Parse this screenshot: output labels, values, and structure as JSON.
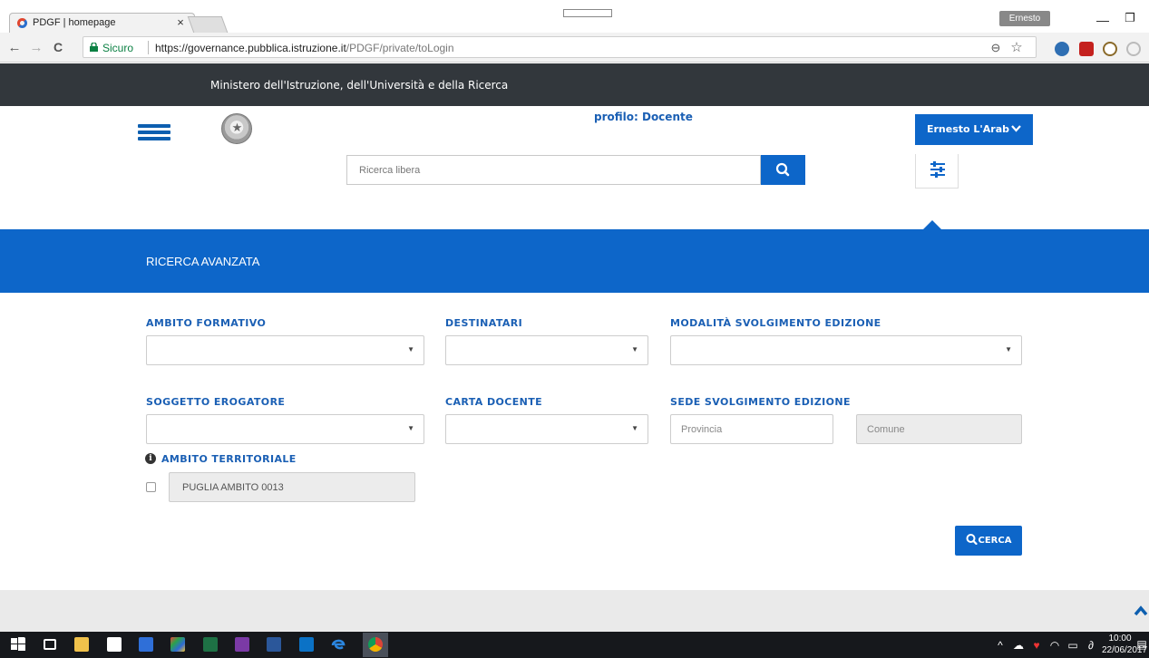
{
  "browser": {
    "tab_title": "PDGF | homepage",
    "tab_close": "×",
    "profile_name": "Ernesto",
    "window_min": "—",
    "window_restore": "❐",
    "nav_back": "←",
    "nav_forward": "→",
    "nav_reload": "C",
    "secure_label": "Sicuro",
    "url_host": "https://governance.pubblica.istruzione.it",
    "url_path": "/PDGF/private/toLogin",
    "zoom_icon": "⊖",
    "star_icon": "☆"
  },
  "site": {
    "ministry_title": "Ministero dell'Istruzione, dell'Università e della Ricerca",
    "profile_label": "profilo: Docente",
    "user_name": "Ernesto L'Arab",
    "search_placeholder": "Ricerca libera"
  },
  "advanced": {
    "title": "RICERCA AVANZATA",
    "ambito_formativo_label": "AMBITO FORMATIVO",
    "destinatari_label": "DESTINATARI",
    "modalita_label": "MODALITÀ SVOLGIMENTO EDIZIONE",
    "soggetto_label": "SOGGETTO EROGATORE",
    "carta_docente_label": "CARTA DOCENTE",
    "sede_label": "SEDE SVOLGIMENTO EDIZIONE",
    "provincia_placeholder": "Provincia",
    "comune_placeholder": "Comune",
    "info_glyph": "i",
    "ambito_territoriale_label": "AMBITO TERRITORIALE",
    "ambito_territoriale_value": "PUGLIA AMBITO 0013",
    "search_button": "CERCA",
    "caret": "▼"
  },
  "taskbar": {
    "time": "10:00",
    "date": "22/06/2017",
    "icons": [
      "windows-start-icon",
      "task-view-icon",
      "file-explorer-icon",
      "store-icon",
      "dropbox-icon",
      "paint-icon",
      "excel-icon",
      "onenote-icon",
      "word-icon",
      "outlook-icon",
      "edge-icon",
      "chrome-icon"
    ],
    "tray_icons": [
      "tray-chevron-icon",
      "onedrive-icon",
      "antivirus-icon",
      "wifi-icon",
      "battery-icon",
      "pen-icon",
      "notification-icon"
    ]
  },
  "colors": {
    "brand_blue": "#0d66c9",
    "label_blue": "#1a5fb4",
    "header_dark": "#32373c",
    "secure_green": "#0b8043"
  }
}
